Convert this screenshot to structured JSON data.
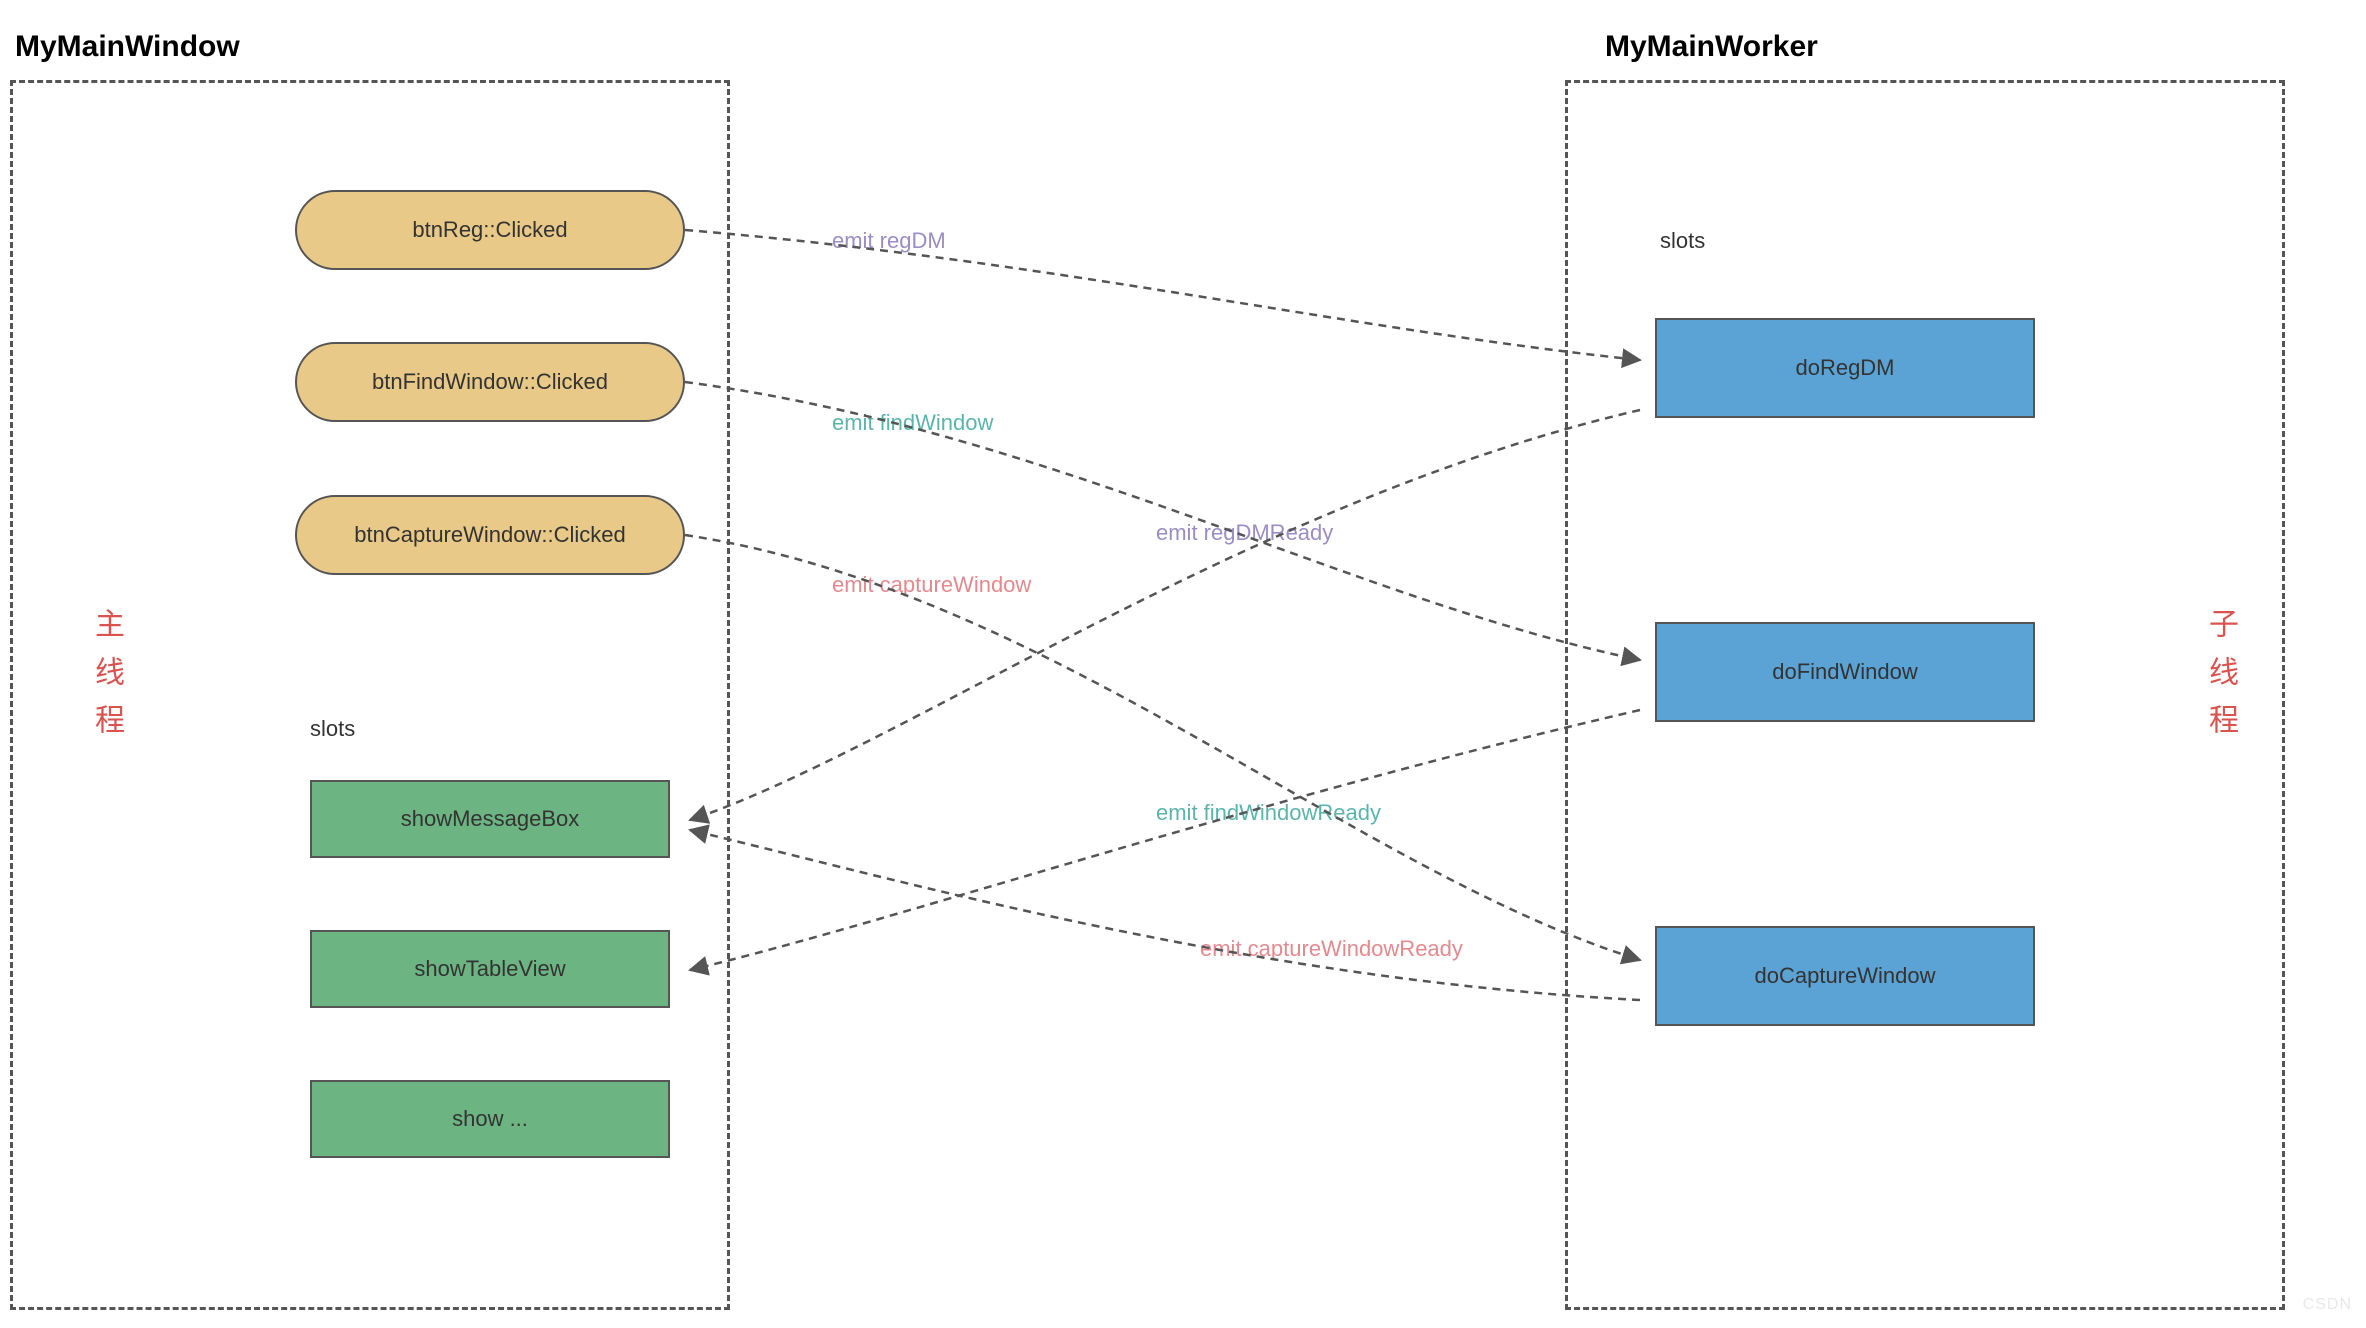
{
  "left": {
    "title": "MyMainWindow",
    "vertical_label": "主线程",
    "slots_label": "slots",
    "buttons": {
      "btnReg": "btnReg::Clicked",
      "btnFindWindow": "btnFindWindow::Clicked",
      "btnCaptureWindow": "btnCaptureWindow::Clicked"
    },
    "slots": {
      "showMessageBox": "showMessageBox",
      "showTableView": "showTableView",
      "showMore": "show ..."
    }
  },
  "right": {
    "title": "MyMainWorker",
    "vertical_label": "子线程",
    "slots_label": "slots",
    "slots": {
      "doRegDM": "doRegDM",
      "doFindWindow": "doFindWindow",
      "doCaptureWindow": "doCaptureWindow"
    }
  },
  "emits": {
    "regDM": "emit regDM",
    "findWindow": "emit findWindow",
    "captureWindow": "emit captureWindow",
    "regDMReady": "emit regDMReady",
    "findWindowReady": "emit findWindowReady",
    "captureWindowReady": "emit captureWindowReady"
  },
  "watermark": "CSDN"
}
